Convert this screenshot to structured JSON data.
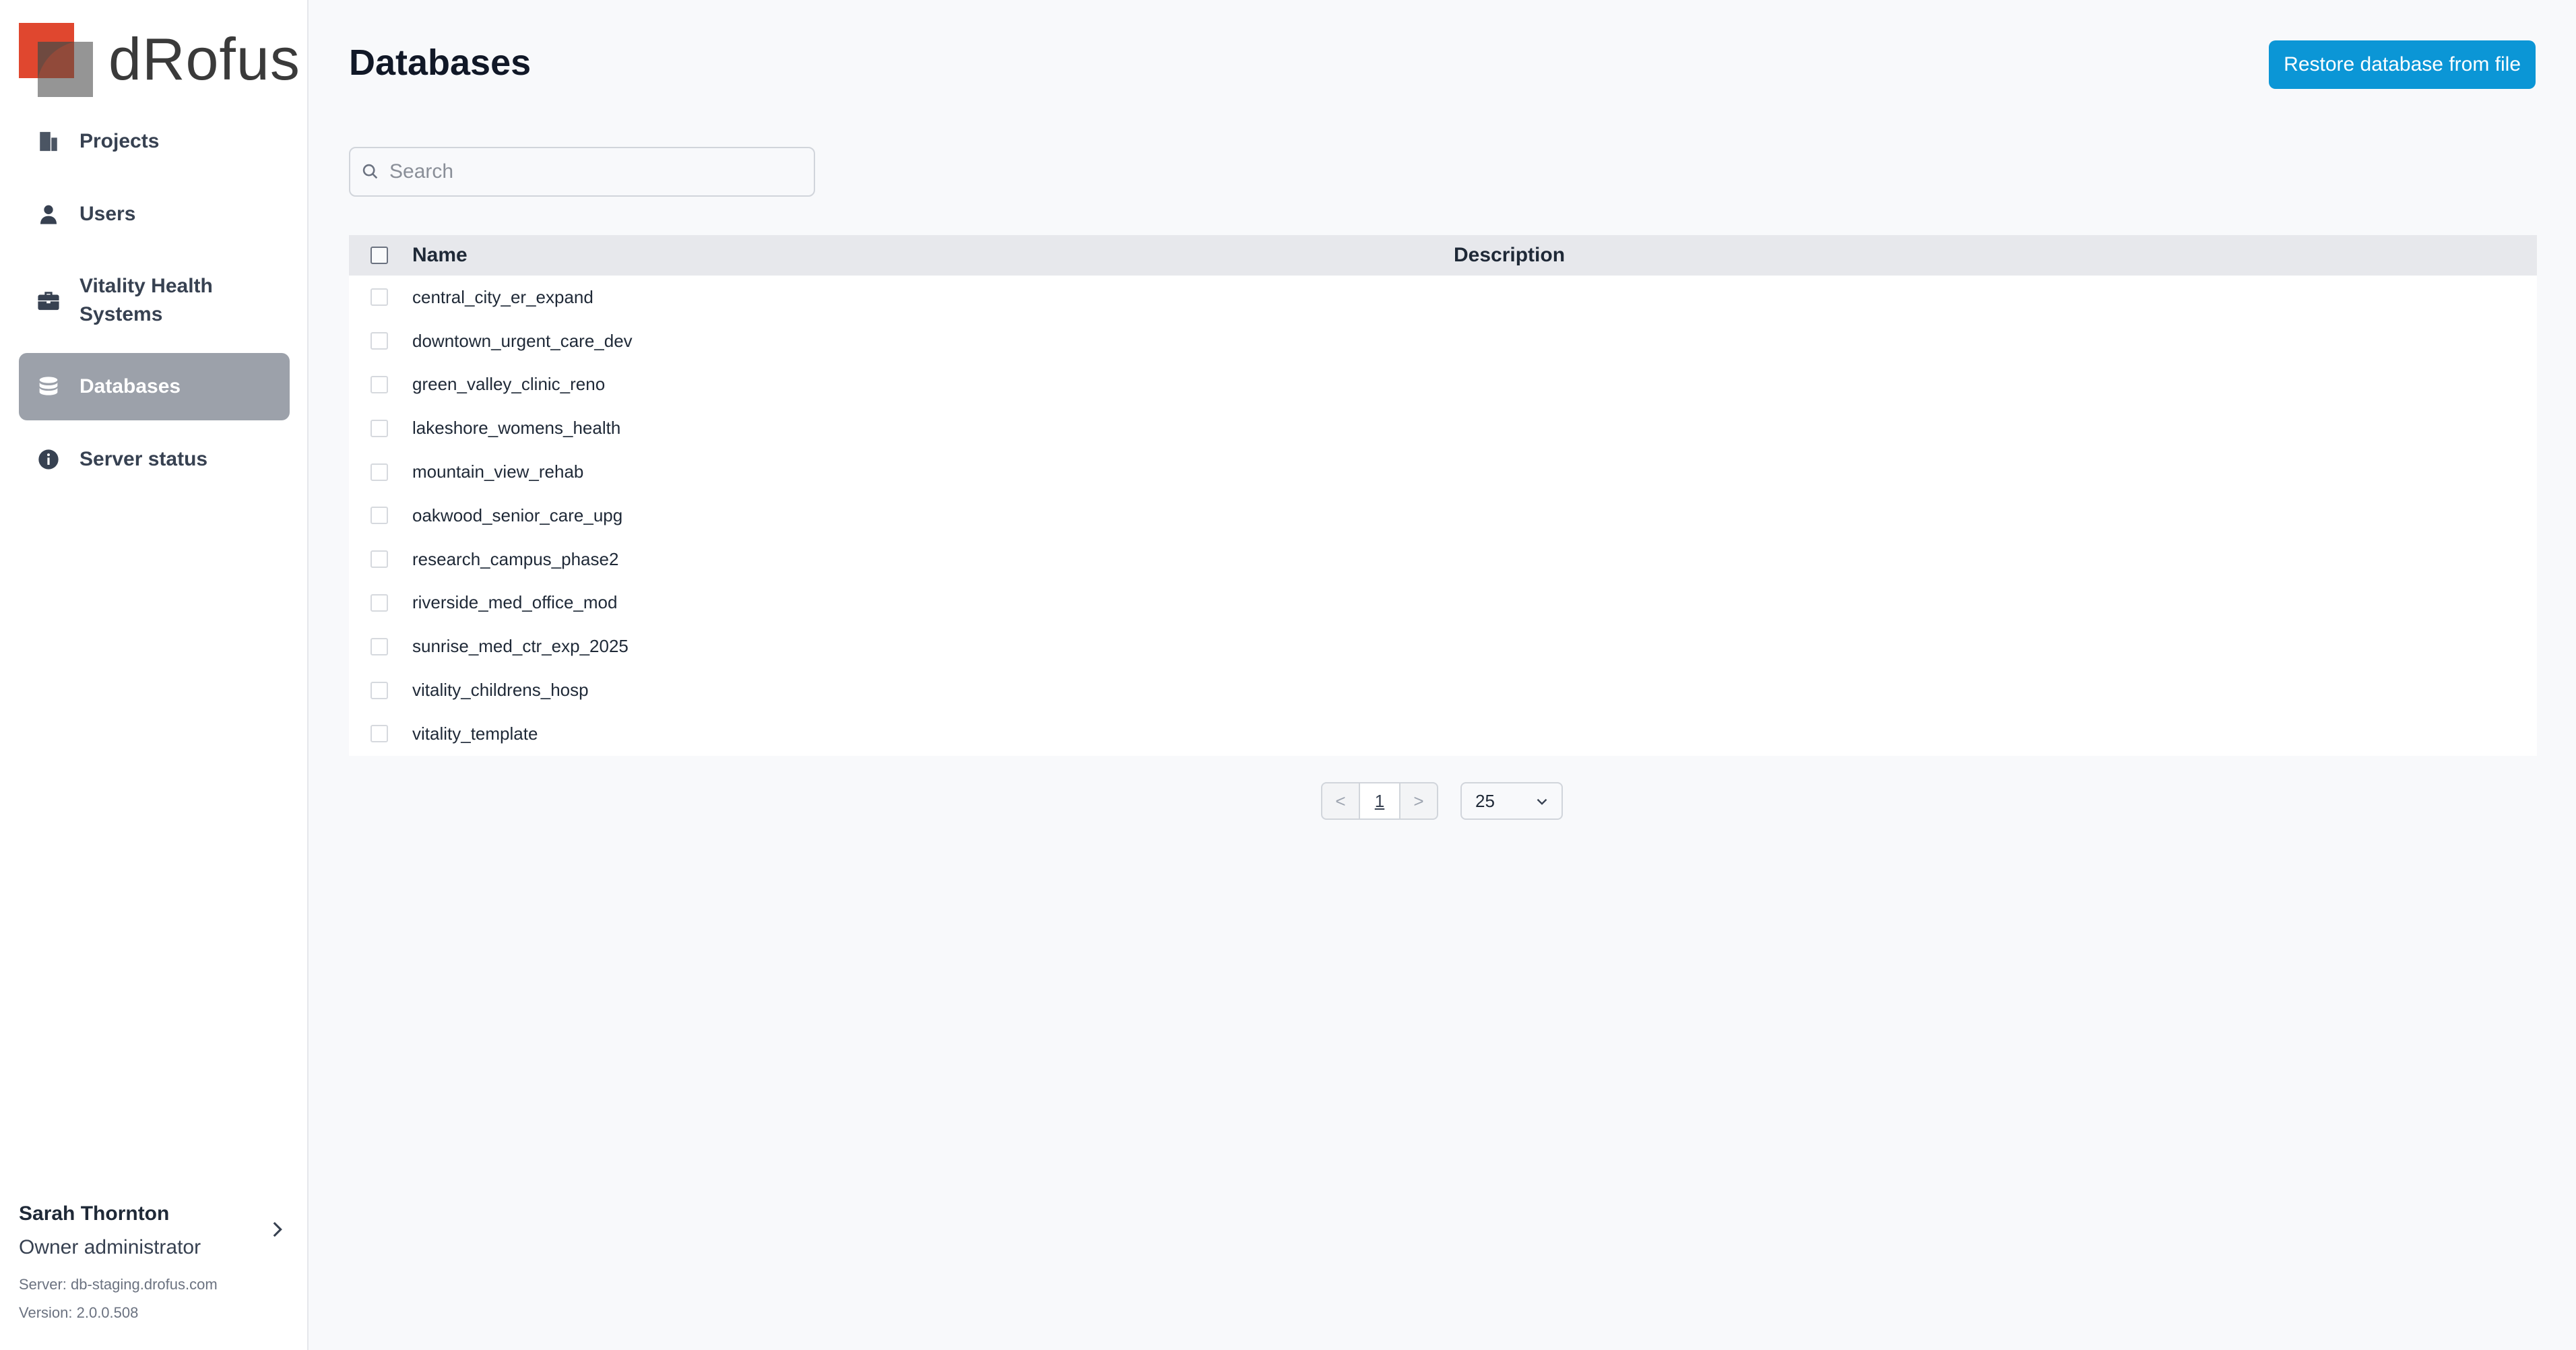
{
  "brand": {
    "name": "dRofus",
    "accent": "#0b96d6",
    "logo_red": "#e0472f",
    "logo_gray": "#8a8a8a"
  },
  "sidebar": {
    "items": [
      {
        "label": "Projects",
        "icon": "building-icon"
      },
      {
        "label": "Users",
        "icon": "user-icon"
      },
      {
        "label": "Vitality Health Systems",
        "icon": "briefcase-icon"
      },
      {
        "label": "Databases",
        "icon": "database-icon",
        "active": true
      },
      {
        "label": "Server status",
        "icon": "info-icon"
      }
    ],
    "user": {
      "name": "Sarah Thornton",
      "role": "Owner administrator"
    },
    "server": "Server: db-staging.drofus.com",
    "version": "Version: 2.0.0.508"
  },
  "main": {
    "title": "Databases",
    "restore_label": "Restore database from file",
    "search_placeholder": "Search",
    "columns": {
      "name": "Name",
      "description": "Description"
    },
    "rows": [
      {
        "name": "central_city_er_expand",
        "description": ""
      },
      {
        "name": "downtown_urgent_care_dev",
        "description": ""
      },
      {
        "name": "green_valley_clinic_reno",
        "description": ""
      },
      {
        "name": "lakeshore_womens_health",
        "description": ""
      },
      {
        "name": "mountain_view_rehab",
        "description": ""
      },
      {
        "name": "oakwood_senior_care_upg",
        "description": ""
      },
      {
        "name": "research_campus_phase2",
        "description": ""
      },
      {
        "name": "riverside_med_office_mod",
        "description": ""
      },
      {
        "name": "sunrise_med_ctr_exp_2025",
        "description": ""
      },
      {
        "name": "vitality_childrens_hosp",
        "description": ""
      },
      {
        "name": "vitality_template",
        "description": ""
      }
    ],
    "pagination": {
      "prev": "<",
      "current": "1",
      "next": ">",
      "page_size": "25"
    }
  }
}
